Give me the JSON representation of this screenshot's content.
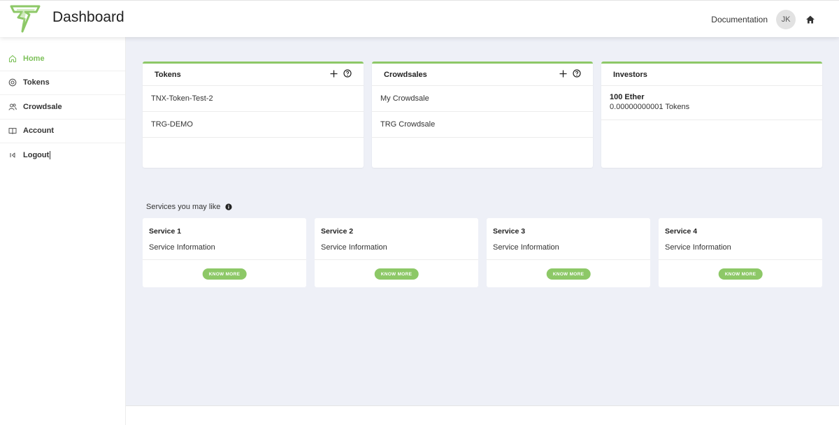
{
  "header": {
    "title": "Dashboard",
    "documentation_label": "Documentation",
    "avatar_initials": "JK",
    "logo_icon": "lightning-logo-icon",
    "home_icon": "home-icon"
  },
  "sidebar": {
    "items": [
      {
        "label": "Home",
        "icon": "home-icon",
        "active": true
      },
      {
        "label": "Tokens",
        "icon": "token-icon",
        "active": false
      },
      {
        "label": "Crowdsale",
        "icon": "users-icon",
        "active": false
      },
      {
        "label": "Account",
        "icon": "book-icon",
        "active": false
      },
      {
        "label": "Logout",
        "icon": "logout-icon",
        "active": false
      }
    ]
  },
  "cards": {
    "tokens": {
      "title": "Tokens",
      "rows": [
        "TNX-Token-Test-2",
        "TRG-DEMO"
      ]
    },
    "crowdsales": {
      "title": "Crowdsales",
      "rows": [
        "My Crowdsale",
        "TRG Crowdsale"
      ]
    },
    "investors": {
      "title": "Investors",
      "amount": "100 Ether",
      "tokens": "0.00000000001 Tokens"
    }
  },
  "services": {
    "title": "Services you may like",
    "items": [
      {
        "name": "Service 1",
        "info": "Service Information",
        "button": "KNOW MORE"
      },
      {
        "name": "Service 2",
        "info": "Service Information",
        "button": "KNOW MORE"
      },
      {
        "name": "Service 3",
        "info": "Service Information",
        "button": "KNOW MORE"
      },
      {
        "name": "Service 4",
        "info": "Service Information",
        "button": "KNOW MORE"
      }
    ]
  },
  "colors": {
    "accent": "#8dc867",
    "active_nav": "#7dc15a",
    "main_bg": "#eef0f7"
  }
}
